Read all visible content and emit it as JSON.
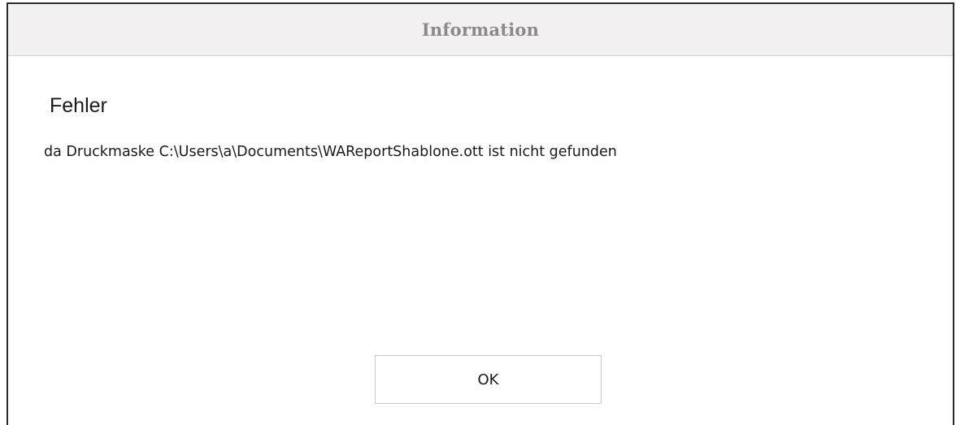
{
  "dialog": {
    "title": "Information",
    "heading": "Fehler",
    "message": "da Druckmaske C:\\Users\\a\\Documents\\WAReportShablone.ott ist nicht gefunden",
    "ok_label": "OK"
  }
}
